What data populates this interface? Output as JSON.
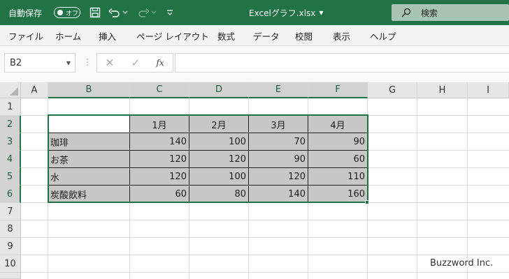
{
  "titlebar": {
    "autosave_label": "自動保存",
    "autosave_state": "オフ",
    "title": "Excelグラフ.xlsx",
    "search_label": "検索",
    "bg_color": "#217346"
  },
  "ribbon": {
    "tabs": [
      "ファイル",
      "ホーム",
      "挿入",
      "ページ レイアウト",
      "数式",
      "データ",
      "校閲",
      "表示",
      "ヘルプ"
    ]
  },
  "formula_bar": {
    "name_box": "B2",
    "fx_label": "fx",
    "formula": ""
  },
  "sheet": {
    "columns": [
      "A",
      "B",
      "C",
      "D",
      "E",
      "F",
      "G",
      "H",
      "I"
    ],
    "rows": [
      "1",
      "2",
      "3",
      "4",
      "5",
      "6",
      "7",
      "8",
      "9",
      "10"
    ],
    "table": {
      "header": [
        "",
        "1月",
        "2月",
        "3月",
        "4月"
      ],
      "rows": [
        [
          "珈琲",
          "140",
          "100",
          "70",
          "90"
        ],
        [
          "お茶",
          "120",
          "120",
          "90",
          "60"
        ],
        [
          "水",
          "120",
          "100",
          "120",
          "110"
        ],
        [
          "炭酸飲料",
          "60",
          "80",
          "140",
          "160"
        ]
      ]
    },
    "selection": "B2:F6"
  },
  "watermark": "Buzzword Inc."
}
